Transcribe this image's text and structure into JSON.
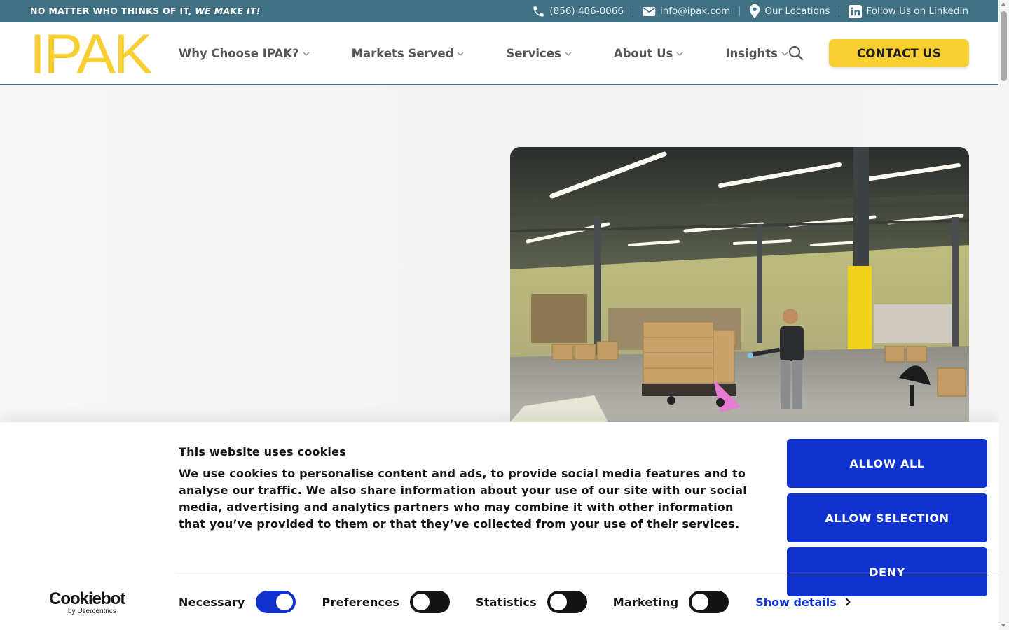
{
  "topbar": {
    "tagline_plain": "NO MATTER WHO THINKS OF IT, ",
    "tagline_emphasis": "WE MAKE IT!",
    "phone": "(856) 486-0066",
    "email": "info@ipak.com",
    "locations": "Our Locations",
    "linkedin": "Follow Us on LinkedIn"
  },
  "header": {
    "logo": "IPAK",
    "nav": [
      {
        "label": "Why Choose IPAK?"
      },
      {
        "label": "Markets Served"
      },
      {
        "label": "Services"
      },
      {
        "label": "About Us"
      },
      {
        "label": "Insights"
      }
    ],
    "contact_label": "CONTACT US"
  },
  "colors": {
    "topbar_bg": "#3f7084",
    "brand_yellow": "#f7cf32",
    "cookie_blue": "#1032cf"
  },
  "cookie": {
    "title": "This website uses cookies",
    "body": "We use cookies to personalise content and ads, to provide social media features and to analyse our traffic. We also share information about your use of our site with our social media, advertising and analytics partners who may combine it with other information that you’ve provided to them or that they’ve collected from your use of their services.",
    "buttons": {
      "allow_all": "ALLOW ALL",
      "allow_selection": "ALLOW SELECTION",
      "deny": "DENY"
    },
    "brand": "Cookiebot",
    "brand_sub": "by Usercentrics",
    "consents": [
      {
        "label": "Necessary",
        "checked": true
      },
      {
        "label": "Preferences",
        "checked": false
      },
      {
        "label": "Statistics",
        "checked": false
      },
      {
        "label": "Marketing",
        "checked": false
      }
    ],
    "show_details": "Show details"
  }
}
